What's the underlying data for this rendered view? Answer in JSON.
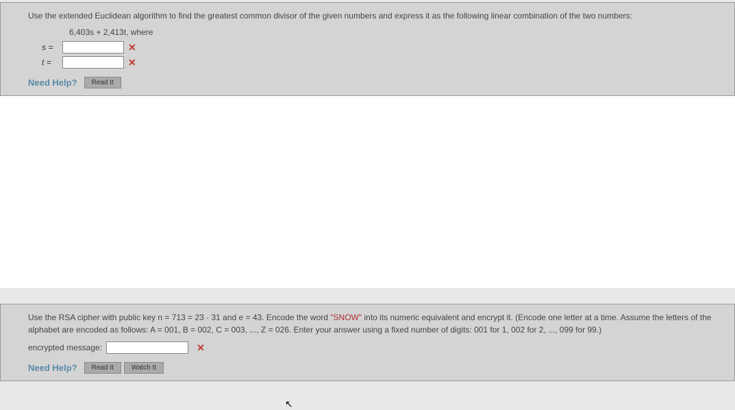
{
  "q1": {
    "prompt": "Use the extended Euclidean algorithm to find the greatest common divisor of the given numbers and express it as the following linear combination of the two numbers:",
    "expression": "6,403s + 2,413t, where",
    "var_s": "s =",
    "var_t": "t =",
    "help_label": "Need Help?",
    "read_btn": "Read It"
  },
  "q2": {
    "prompt_part1": "Use the RSA cipher with public key n = 713 = 23 · 31 and e = 43. Encode the word ",
    "snow": "\"SNOW\"",
    "prompt_part2": " into its numeric equivalent and encrypt it. (Encode one letter at a time. Assume the letters of the alphabet are encoded as follows: A = 001, B = 002, C = 003, ..., Z = 026. Enter your answer using a fixed number of digits: 001 for 1, 002 for 2, ..., 099 for 99.)",
    "encrypted_label": "encrypted message:",
    "help_label": "Need Help?",
    "read_btn": "Read It",
    "watch_btn": "Watch It"
  }
}
